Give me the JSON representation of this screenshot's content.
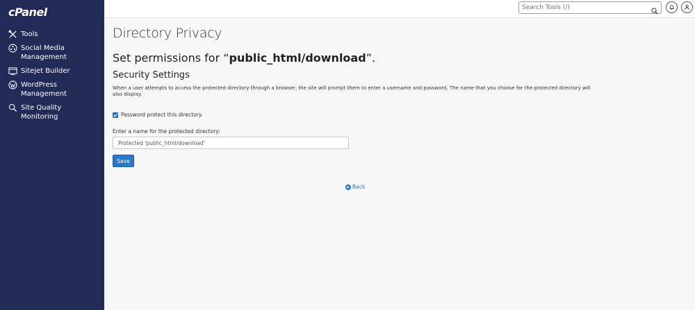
{
  "sidebar": {
    "logo": "cPanel",
    "items": [
      {
        "label": "Tools",
        "icon": "tools-icon"
      },
      {
        "label": "Social Media Management",
        "icon": "social-media-icon"
      },
      {
        "label": "Sitejet Builder",
        "icon": "sitejet-icon"
      },
      {
        "label": "WordPress Management",
        "icon": "wordpress-icon"
      },
      {
        "label": "Site Quality Monitoring",
        "icon": "site-quality-icon"
      }
    ]
  },
  "topbar": {
    "search_placeholder": "Search Tools (/)"
  },
  "main": {
    "page_title": "Directory Privacy",
    "heading_prefix": "Set permissions for “",
    "heading_path": "public_html/download",
    "heading_suffix": "”.",
    "section_title": "Security Settings",
    "description": "When a user attempts to access the protected directory through a browser, the site will prompt them to enter a username and password. The name that you choose for the protected directory will also display.",
    "checkbox_label": "Password protect this directory.",
    "checkbox_checked": true,
    "name_label": "Enter a name for the protected directory:",
    "name_value": "Protected 'public_html/download'",
    "save_label": "Save",
    "back_label": "Back"
  },
  "colors": {
    "sidebar_bg": "#222a58",
    "accent": "#2c77c8"
  }
}
